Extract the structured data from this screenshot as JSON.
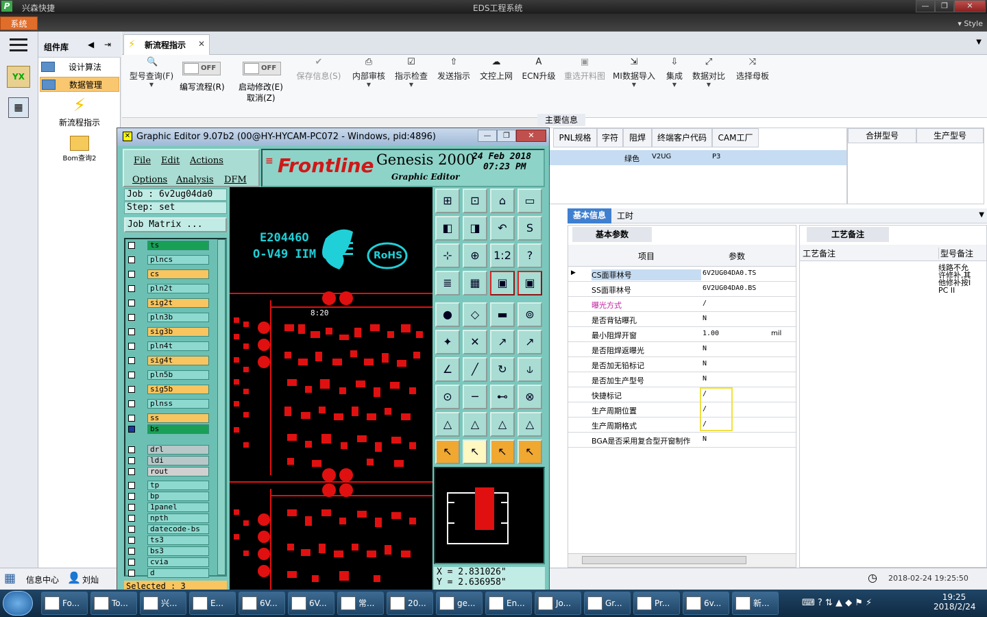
{
  "app": {
    "title": "兴森快捷",
    "window_title": "EDS工程系统",
    "style_label": "Style",
    "system_menu": "系统"
  },
  "left_nav": {
    "library_title": "组件库",
    "items": [
      {
        "label": "设计算法"
      },
      {
        "label": "数据管理"
      }
    ],
    "launchers": [
      {
        "label": "新流程指示"
      },
      {
        "label": "Bom查询2"
      }
    ]
  },
  "doc_tab": {
    "label": "新流程指示"
  },
  "toolbar": {
    "buttons": [
      {
        "label": "型号查询(F)",
        "icon": "search-icon"
      },
      {
        "label": "编写流程(R)",
        "toggle": "OFF"
      },
      {
        "label": "启动修改(E)",
        "sub": "取消(Z)",
        "toggle": "OFF"
      },
      {
        "label": "保存信息(S)",
        "disabled": true
      },
      {
        "label": "内部审核"
      },
      {
        "label": "指示检查"
      },
      {
        "label": "发送指示"
      },
      {
        "label": "文控上网"
      },
      {
        "label": "ECN升级"
      },
      {
        "label": "重选开料图",
        "disabled": true
      },
      {
        "label": "MI数据导入"
      },
      {
        "label": "集成"
      },
      {
        "label": "数据对比"
      },
      {
        "label": "选择母板"
      }
    ]
  },
  "main_info": {
    "title": "主要信息",
    "columns": [
      "PNL规格",
      "字符",
      "阻焊",
      "终端客户代码",
      "CAM工厂"
    ],
    "row": [
      "",
      "",
      "绿色",
      "V2UG",
      "P3"
    ],
    "right_columns": [
      "合拼型号",
      "生产型号"
    ]
  },
  "info_tabs": [
    "基本信息",
    "工时"
  ],
  "params": {
    "tab": "基本参数",
    "headers": [
      "项目",
      "参数"
    ],
    "rows": [
      {
        "item": "CS面菲林号",
        "value": "6V2UG04DA0.TS",
        "unit": ""
      },
      {
        "item": "SS面菲林号",
        "value": "6V2UG04DA0.BS",
        "unit": ""
      },
      {
        "item": "曝光方式",
        "value": "/",
        "unit": ""
      },
      {
        "item": "是否背钻曝孔",
        "value": "N",
        "unit": ""
      },
      {
        "item": "最小阻焊开窗",
        "value": "1.00",
        "unit": "mil"
      },
      {
        "item": "是否阻焊返曝光",
        "value": "N",
        "unit": ""
      },
      {
        "item": "是否加无铅标记",
        "value": "N",
        "unit": ""
      },
      {
        "item": "是否加生产型号",
        "value": "N",
        "unit": ""
      },
      {
        "item": "快捷标记",
        "value": "/",
        "unit": ""
      },
      {
        "item": "生产周期位置",
        "value": "/",
        "unit": ""
      },
      {
        "item": "生产周期格式",
        "value": "/",
        "unit": ""
      },
      {
        "item": "BGA是否采用复合型开窗制作",
        "value": "N",
        "unit": ""
      }
    ]
  },
  "craft": {
    "tab": "工艺备注",
    "col1": "工艺备注",
    "col2": "型号备注",
    "note": "线路不允许修补,其他修补按IPC II"
  },
  "graphic_editor": {
    "title": "Graphic Editor 9.07b2 (00@HY-HYCAM-PC072 - Windows, pid:4896)",
    "menu": [
      "File",
      "Edit",
      "Actions",
      "Options",
      "Analysis",
      "DFM"
    ],
    "brand": "Frontline",
    "product": "Genesis 2000",
    "subtitle": "Graphic Editor",
    "date": "24 Feb 2018",
    "time": "07:23 PM",
    "job": "Job : 6v2ug04da0",
    "step": "Step: set",
    "job_matrix": "Job Matrix ...",
    "layers": [
      {
        "name": "ts",
        "color": "#1a9f57"
      },
      {
        "name": "plncs",
        "color": "#8dd9cf"
      },
      {
        "name": "cs",
        "color": "#f8c560"
      },
      {
        "name": "pln2t",
        "color": "#8dd9cf"
      },
      {
        "name": "sig2t",
        "color": "#f8c560"
      },
      {
        "name": "pln3b",
        "color": "#8dd9cf"
      },
      {
        "name": "sig3b",
        "color": "#f8c560"
      },
      {
        "name": "pln4t",
        "color": "#8dd9cf"
      },
      {
        "name": "sig4t",
        "color": "#f8c560"
      },
      {
        "name": "pln5b",
        "color": "#8dd9cf"
      },
      {
        "name": "sig5b",
        "color": "#f8c560"
      },
      {
        "name": "plnss",
        "color": "#8dd9cf"
      },
      {
        "name": "ss",
        "color": "#f8c560"
      },
      {
        "name": "bs",
        "color": "#1a9f57"
      },
      {
        "name": "drl",
        "color": "#b8c8c8"
      },
      {
        "name": "ldi",
        "color": "#b8c8c8"
      },
      {
        "name": "rout",
        "color": "#d0d0d0"
      },
      {
        "name": "tp",
        "color": "#8dd9cf"
      },
      {
        "name": "bp",
        "color": "#8dd9cf"
      },
      {
        "name": "1panel",
        "color": "#8dd9cf"
      },
      {
        "name": "npth",
        "color": "#8dd9cf"
      },
      {
        "name": "datecode-bs",
        "color": "#8dd9cf"
      },
      {
        "name": "ts3",
        "color": "#8dd9cf"
      },
      {
        "name": "bs3",
        "color": "#8dd9cf"
      },
      {
        "name": "cvia",
        "color": "#8dd9cf"
      },
      {
        "name": "d",
        "color": "#8dd9cf"
      }
    ],
    "selected": "Selected : 3",
    "coord_x": "X = 2.831026\"",
    "coord_y": "Y = 2.636958\"",
    "board_text1": "E20446O",
    "board_text2": "O-V49 IIM",
    "board_text3": "RoHS",
    "board_text4": "8:20"
  },
  "status": {
    "info_center": "信息中心",
    "user": "刘灿",
    "datetime": "2018-02-24 19:25:50"
  },
  "taskbar": {
    "items": [
      "Fo...",
      "To...",
      "兴...",
      "E...",
      "6V...",
      "6V...",
      "常...",
      "20...",
      "ge...",
      "En...",
      "Jo...",
      "Gr...",
      "Pr...",
      "6v...",
      "新..."
    ],
    "clock_time": "19:25",
    "clock_date": "2018/2/24"
  }
}
